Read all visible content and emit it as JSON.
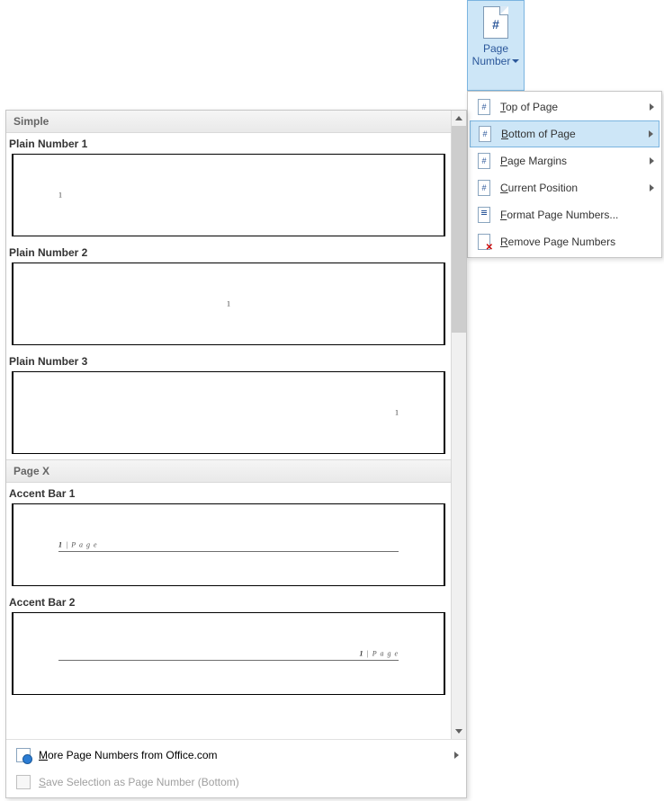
{
  "ribbon": {
    "pageNumber": {
      "line1": "Page",
      "line2": "Number"
    }
  },
  "menu": {
    "items": [
      {
        "key": "top",
        "label_pre": "",
        "label_ul": "T",
        "label_post": "op of Page",
        "hasSub": true
      },
      {
        "key": "bottom",
        "label_pre": "",
        "label_ul": "B",
        "label_post": "ottom of Page",
        "hasSub": true,
        "hovered": true
      },
      {
        "key": "margins",
        "label_pre": "",
        "label_ul": "P",
        "label_post": "age Margins",
        "hasSub": true
      },
      {
        "key": "current",
        "label_pre": "",
        "label_ul": "C",
        "label_post": "urrent Position",
        "hasSub": true
      },
      {
        "key": "format",
        "label_pre": "",
        "label_ul": "F",
        "label_post": "ormat Page Numbers...",
        "hasSub": false
      },
      {
        "key": "remove",
        "label_pre": "",
        "label_ul": "R",
        "label_post": "emove Page Numbers",
        "hasSub": false
      }
    ]
  },
  "gallery": {
    "groups": [
      {
        "title": "Simple",
        "items": [
          {
            "name": "Plain Number 1",
            "style": "plain-left"
          },
          {
            "name": "Plain Number 2",
            "style": "plain-center"
          },
          {
            "name": "Plain Number 3",
            "style": "plain-right"
          }
        ]
      },
      {
        "title": "Page X",
        "items": [
          {
            "name": "Accent Bar 1",
            "style": "accent-left"
          },
          {
            "name": "Accent Bar 2",
            "style": "accent-right"
          }
        ]
      }
    ],
    "accentWord": "P a g e",
    "footer": {
      "more": {
        "pre": "",
        "ul": "M",
        "post": "ore Page Numbers from Office.com"
      },
      "save": {
        "pre": "",
        "ul": "S",
        "post": "ave Selection as Page Number (Bottom)",
        "disabled": true
      }
    }
  }
}
